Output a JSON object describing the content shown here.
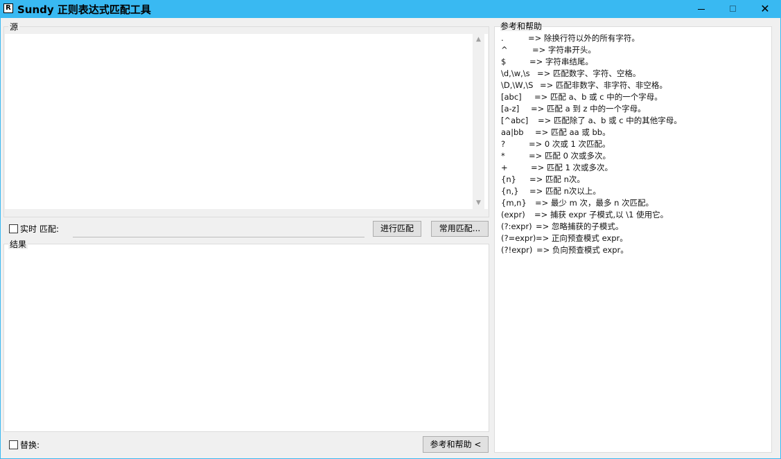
{
  "window": {
    "title": "Sundy 正则表达式匹配工具",
    "app_icon_glyph": "R",
    "minimize_icon": "minimize-icon",
    "maximize_icon": "maximize-icon",
    "close_icon": "close-icon",
    "close_glyph": "✕"
  },
  "source": {
    "label": "源",
    "value": ""
  },
  "match_bar": {
    "realtime_label": "实时",
    "match_label": "匹配:",
    "pattern_value": "",
    "run_button": "进行匹配",
    "common_button": "常用匹配..."
  },
  "result": {
    "label": "结果",
    "value": ""
  },
  "bottom": {
    "replace_label": "替换:",
    "help_toggle_button": "参考和帮助 <"
  },
  "help": {
    "title": "参考和帮助",
    "lines": [
      {
        "pattern": ".",
        "desc": "=> 除换行符以外的所有字符。"
      },
      {
        "pattern": "^",
        "desc": "=> 字符串开头。"
      },
      {
        "pattern": "$",
        "desc": "=> 字符串结尾。"
      },
      {
        "pattern": "\\d,\\w,\\s",
        "desc": "=> 匹配数字、字符、空格。"
      },
      {
        "pattern": "\\D,\\W,\\S",
        "desc": "=> 匹配非数字、非字符、非空格。"
      },
      {
        "pattern": "[abc]",
        "desc": "=> 匹配 a、b 或 c 中的一个字母。"
      },
      {
        "pattern": "[a-z]",
        "desc": "=> 匹配 a 到 z 中的一个字母。"
      },
      {
        "pattern": "[^abc]",
        "desc": "=> 匹配除了 a、b 或 c 中的其他字母。"
      },
      {
        "pattern": "aa|bb",
        "desc": "=> 匹配 aa 或 bb。"
      },
      {
        "pattern": "?",
        "desc": "=> 0 次或 1 次匹配。"
      },
      {
        "pattern": "*",
        "desc": "=> 匹配 0 次或多次。"
      },
      {
        "pattern": "+",
        "desc": "=> 匹配 1 次或多次。"
      },
      {
        "pattern": "{n}",
        "desc": "=> 匹配 n次。"
      },
      {
        "pattern": "{n,}",
        "desc": "=> 匹配 n次以上。"
      },
      {
        "pattern": "{m,n}",
        "desc": "=> 最少 m 次，最多 n 次匹配。"
      },
      {
        "pattern": "(expr)",
        "desc": "=> 捕获 expr 子模式,以 \\1 使用它。"
      },
      {
        "pattern": "(?:expr)",
        "desc": "=> 忽略捕获的子模式。"
      },
      {
        "pattern": "(?=expr)",
        "desc": "=> 正向预查模式 expr。"
      },
      {
        "pattern": "(?!expr)",
        "desc": "=> 负向预查模式 expr。"
      }
    ]
  }
}
